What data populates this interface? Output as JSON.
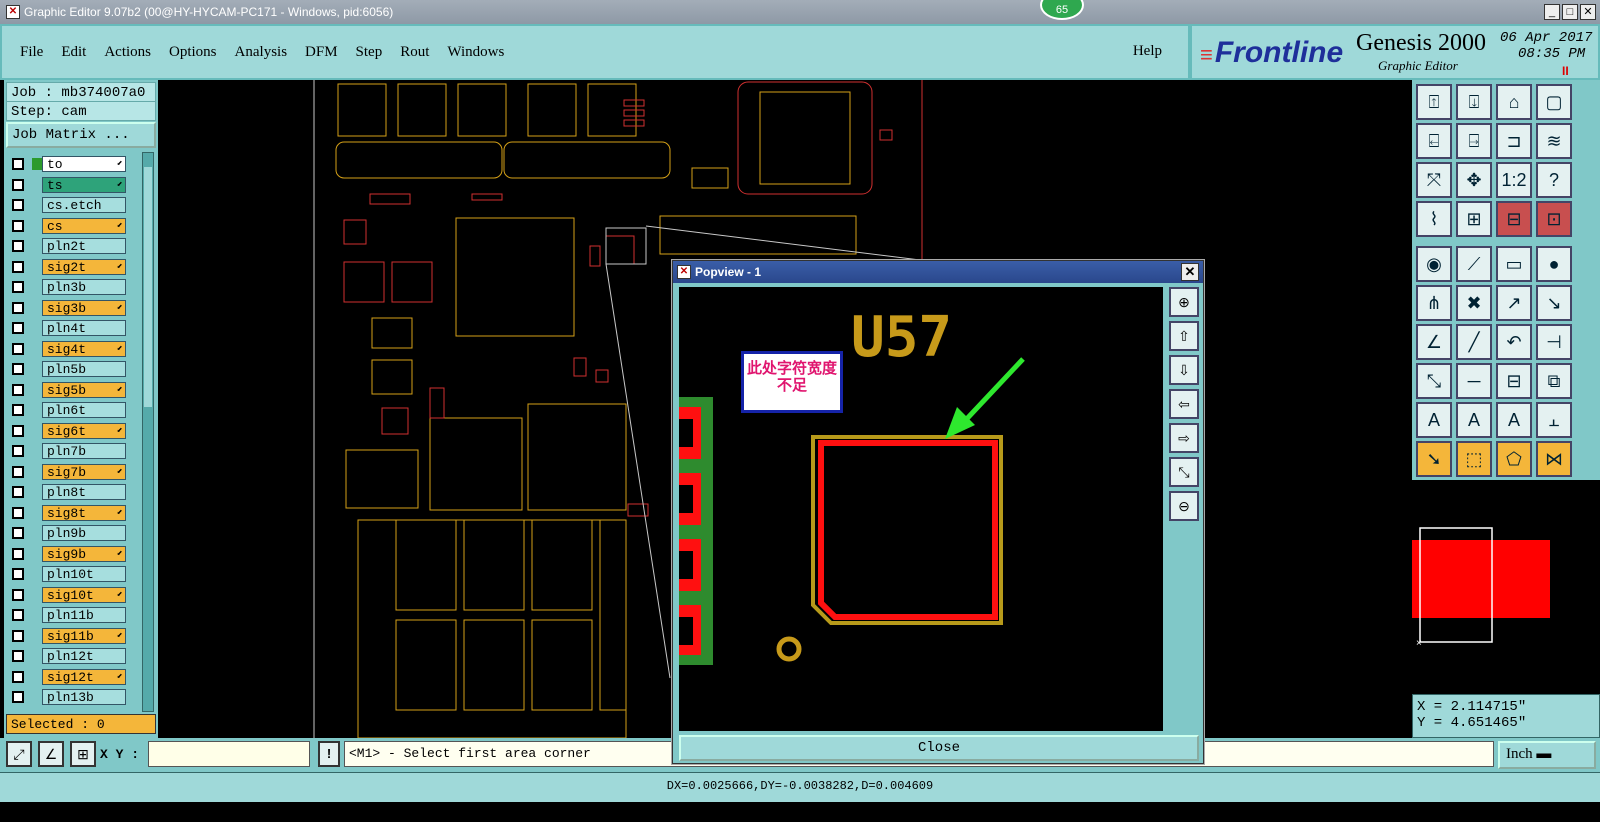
{
  "window": {
    "title": "Graphic Editor 9.07b2 (00@HY-HYCAM-PC171 - Windows, pid:6056)",
    "badge": "65"
  },
  "menu": [
    "File",
    "Edit",
    "Actions",
    "Options",
    "Analysis",
    "DFM",
    "Step",
    "Rout",
    "Windows"
  ],
  "help": "Help",
  "brand": {
    "logo": "Frontline",
    "product": "Genesis 2000",
    "subtitle": "Graphic Editor",
    "date": "06 Apr 2017",
    "time": "08:35 PM",
    "pause": "II"
  },
  "job": {
    "job_line": "Job : mb374007a0",
    "step_line": "Step: cam",
    "matrix_button": "Job Matrix ..."
  },
  "layers": [
    {
      "name": "to",
      "type": "top",
      "arrow": true,
      "tag": true
    },
    {
      "name": "ts",
      "type": "ts",
      "arrow": true,
      "tag": false
    },
    {
      "name": "cs.etch",
      "type": "board",
      "arrow": false,
      "tag": false
    },
    {
      "name": "cs",
      "type": "signal",
      "arrow": true,
      "tag": false
    },
    {
      "name": "pln2t",
      "type": "board",
      "arrow": false,
      "tag": false
    },
    {
      "name": "sig2t",
      "type": "signal",
      "arrow": true,
      "tag": false
    },
    {
      "name": "pln3b",
      "type": "board",
      "arrow": false,
      "tag": false
    },
    {
      "name": "sig3b",
      "type": "signal",
      "arrow": true,
      "tag": false
    },
    {
      "name": "pln4t",
      "type": "board",
      "arrow": false,
      "tag": false
    },
    {
      "name": "sig4t",
      "type": "signal",
      "arrow": true,
      "tag": false
    },
    {
      "name": "pln5b",
      "type": "board",
      "arrow": false,
      "tag": false
    },
    {
      "name": "sig5b",
      "type": "signal",
      "arrow": true,
      "tag": false
    },
    {
      "name": "pln6t",
      "type": "board",
      "arrow": false,
      "tag": false
    },
    {
      "name": "sig6t",
      "type": "signal",
      "arrow": true,
      "tag": false
    },
    {
      "name": "pln7b",
      "type": "board",
      "arrow": false,
      "tag": false
    },
    {
      "name": "sig7b",
      "type": "signal",
      "arrow": true,
      "tag": false
    },
    {
      "name": "pln8t",
      "type": "board",
      "arrow": false,
      "tag": false
    },
    {
      "name": "sig8t",
      "type": "signal",
      "arrow": true,
      "tag": false
    },
    {
      "name": "pln9b",
      "type": "board",
      "arrow": false,
      "tag": false
    },
    {
      "name": "sig9b",
      "type": "signal",
      "arrow": true,
      "tag": false
    },
    {
      "name": "pln10t",
      "type": "board",
      "arrow": false,
      "tag": false
    },
    {
      "name": "sig10t",
      "type": "signal",
      "arrow": true,
      "tag": false
    },
    {
      "name": "pln11b",
      "type": "board",
      "arrow": false,
      "tag": false
    },
    {
      "name": "sig11b",
      "type": "signal",
      "arrow": true,
      "tag": false
    },
    {
      "name": "pln12t",
      "type": "board",
      "arrow": false,
      "tag": false
    },
    {
      "name": "sig12t",
      "type": "signal",
      "arrow": true,
      "tag": false
    },
    {
      "name": "pln13b",
      "type": "board",
      "arrow": false,
      "tag": false
    }
  ],
  "selected": "Selected : 0",
  "coords": {
    "x": "X = 2.114715\"",
    "y": "Y = 4.651465\""
  },
  "bottom": {
    "xy_label": "X Y :",
    "xy_value": "",
    "message": "<M1> - Select first area corner",
    "units": "Inch",
    "distance": "DX=0.0025666,DY=-0.0038282,D=0.004609"
  },
  "popview": {
    "title": "Popview - 1",
    "ref_label": "U57",
    "note": "此处字符宽度不足",
    "close": "Close"
  },
  "colors": {
    "panel": "#80c8c8",
    "menu": "#9fd9d9",
    "signal_layer": "#f4b63a",
    "trace": "#d4a017",
    "pad": "#ff0000"
  }
}
